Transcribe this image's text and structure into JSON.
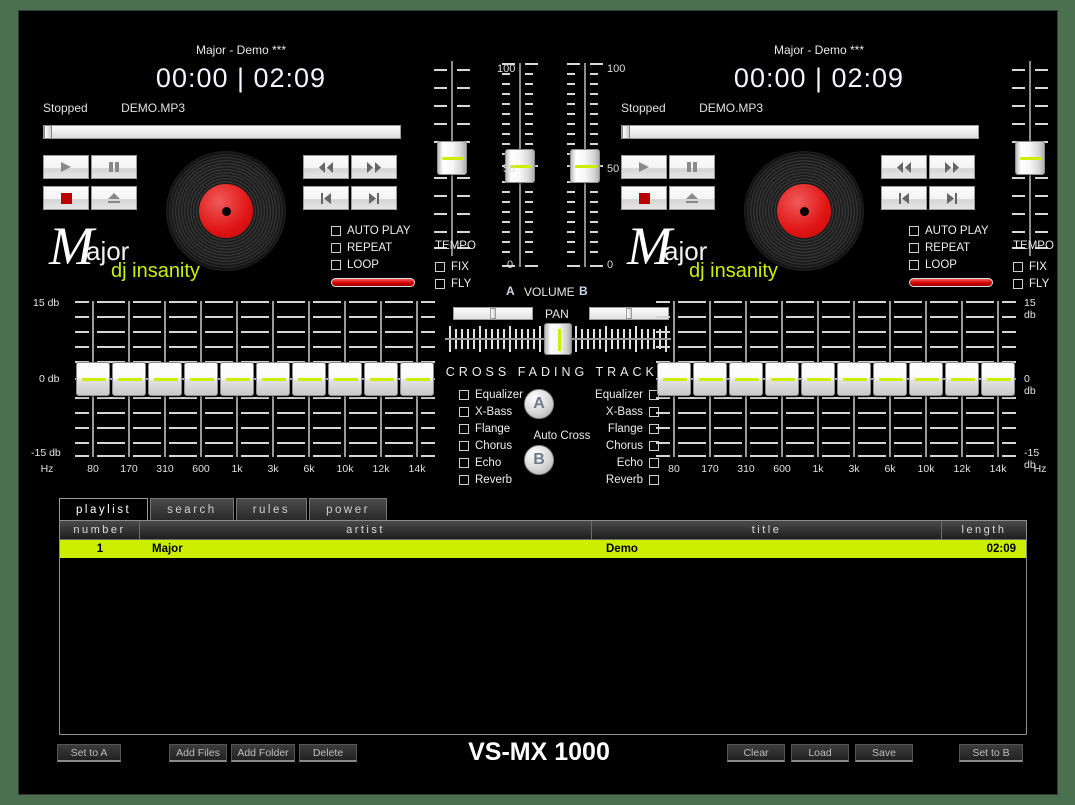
{
  "app": {
    "brand": "VS-MX 1000"
  },
  "decks": [
    {
      "id": "a",
      "track_title": "Major - Demo ***",
      "time": "00:00 | 02:09",
      "status": "Stopped",
      "filename": "DEMO.MP3",
      "options": [
        "AUTO PLAY",
        "REPEAT",
        "LOOP"
      ],
      "tempo_label": "TEMPO",
      "tempo_options": [
        "FIX",
        "FLY"
      ],
      "logo_major": "ajor",
      "logo_m": "M",
      "logo_sub": "dj insanity"
    },
    {
      "id": "b",
      "track_title": "Major - Demo ***",
      "time": "00:00 | 02:09",
      "status": "Stopped",
      "filename": "DEMO.MP3",
      "options": [
        "AUTO PLAY",
        "REPEAT",
        "LOOP"
      ],
      "tempo_label": "TEMPO",
      "tempo_options": [
        "FIX",
        "FLY"
      ],
      "logo_major": "ajor",
      "logo_m": "M",
      "logo_sub": "dj insanity"
    }
  ],
  "equalizer": {
    "db_top": "15 db",
    "db_mid": "0 db",
    "db_bottom": "-15 db",
    "bands": [
      "Hz",
      "80",
      "170",
      "310",
      "600",
      "1k",
      "3k",
      "6k",
      "10k",
      "12k",
      "14k"
    ]
  },
  "center": {
    "volume_label": "VOLUME",
    "volume_a": "A",
    "volume_b": "B",
    "scale_top": "100",
    "scale_mid": "50",
    "scale_bottom": "0",
    "pan_label": "PAN",
    "crossfade_label": "CROSS FADING TRACKS",
    "auto_cross_label": "Auto Cross",
    "cue_a": "A",
    "cue_b": "B",
    "effects": [
      "Equalizer",
      "X-Bass",
      "Flange",
      "Chorus",
      "Echo",
      "Reverb"
    ]
  },
  "playlist": {
    "tabs": [
      "playlist",
      "search",
      "rules",
      "power"
    ],
    "active_tab": "playlist",
    "columns": [
      "number",
      "artist",
      "title",
      "length"
    ],
    "rows": [
      {
        "number": "1",
        "artist": "Major",
        "title": "Demo",
        "length": "02:09"
      }
    ]
  },
  "buttons": {
    "set_to_a": "Set to A",
    "add_files": "Add Files",
    "add_folder": "Add Folder",
    "delete": "Delete",
    "clear": "Clear",
    "load": "Load",
    "save": "Save",
    "set_to_b": "Set to B"
  },
  "colors": {
    "accent": "#ccee00",
    "backdrop": "#4a7050",
    "record_red": "#e01414"
  }
}
